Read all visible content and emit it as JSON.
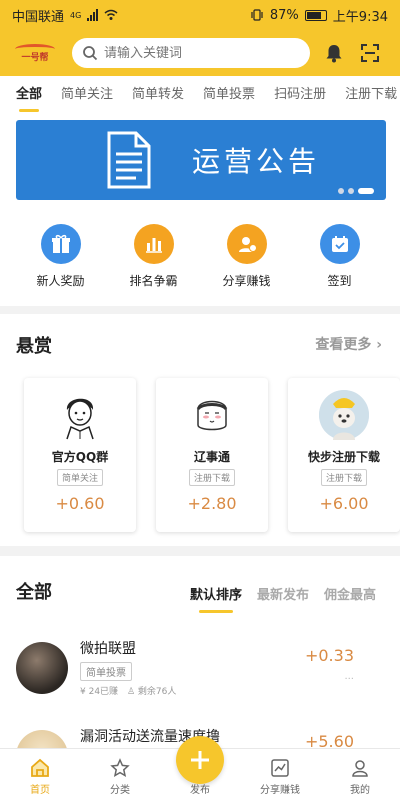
{
  "status_bar": {
    "carrier": "中国联通",
    "network": "4G",
    "battery": "87%",
    "time": "上午9:34"
  },
  "header": {
    "logo_text": "一号帮",
    "search_placeholder": "请输入关键词"
  },
  "tabs": [
    "全部",
    "简单关注",
    "简单转发",
    "简单投票",
    "扫码注册",
    "注册下载"
  ],
  "banner": {
    "text": "运营公告"
  },
  "quick_actions": [
    {
      "label": "新人奖励",
      "icon": "gift-icon",
      "color": "#3d8fe6"
    },
    {
      "label": "排名争霸",
      "icon": "bar-chart-icon",
      "color": "#f4a321"
    },
    {
      "label": "分享赚钱",
      "icon": "share-money-icon",
      "color": "#f4a321"
    },
    {
      "label": "签到",
      "icon": "calendar-icon",
      "color": "#3d8fe6"
    }
  ],
  "bounty": {
    "title": "悬赏",
    "more": "查看更多",
    "cards": [
      {
        "name": "官方QQ群",
        "tag": "简单关注",
        "amount": "+0.60"
      },
      {
        "name": "辽事通",
        "tag": "注册下载",
        "amount": "+2.80"
      },
      {
        "name": "快步注册下载",
        "tag": "注册下载",
        "amount": "+6.00"
      }
    ]
  },
  "all": {
    "title": "全部",
    "sorts": [
      "默认排序",
      "最新发布",
      "佣金最高"
    ],
    "items": [
      {
        "title": "微拍联盟",
        "tag": "简单投票",
        "earned": "24已赚",
        "remaining": "剩余76人",
        "amount": "+0.33"
      },
      {
        "title": "漏洞活动送流量速度撸",
        "tag": "",
        "earned": "",
        "remaining": "",
        "amount": "+5.60"
      }
    ]
  },
  "bottom_nav": [
    "首页",
    "分类",
    "发布",
    "分享赚钱",
    "我的"
  ],
  "colors": {
    "brand_yellow": "#f6c62c",
    "accent_orange": "#d98a43",
    "banner_blue": "#2b7fd3"
  }
}
